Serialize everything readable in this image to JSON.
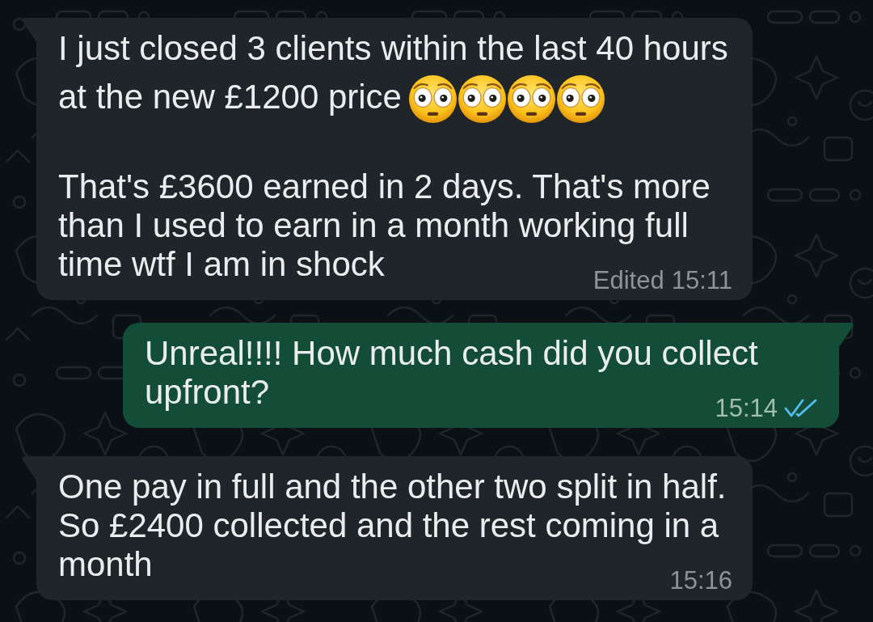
{
  "messages": [
    {
      "kind": "incoming",
      "paragraphs": [
        {
          "lines": [
            {
              "text": "I just closed 3 clients within the last 40 hours"
            },
            {
              "text": "at the new £1200 price",
              "emojis": [
                {
                  "kind": "flushed"
                },
                {
                  "kind": "flushed"
                },
                {
                  "kind": "flushed"
                },
                {
                  "kind": "flushed"
                }
              ]
            }
          ]
        },
        {
          "lines": [
            {
              "text": "That's £3600 earned in 2 days. That's more"
            },
            {
              "text": "than I used to earn in a month working full"
            },
            {
              "text": "time wtf I am in shock"
            }
          ]
        }
      ],
      "edited_label": "Edited",
      "time": "15:11"
    },
    {
      "kind": "outgoing",
      "paragraphs": [
        {
          "lines": [
            {
              "text": "Unreal!!!! How much cash did you collect"
            },
            {
              "text": "upfront?"
            }
          ]
        }
      ],
      "time": "15:14",
      "read": true
    },
    {
      "kind": "incoming",
      "paragraphs": [
        {
          "lines": [
            {
              "text": "One pay in full and the other two split in half."
            },
            {
              "text": "So £2400 collected and the rest coming in a"
            },
            {
              "text": "month"
            }
          ]
        }
      ],
      "time": "15:16"
    }
  ]
}
